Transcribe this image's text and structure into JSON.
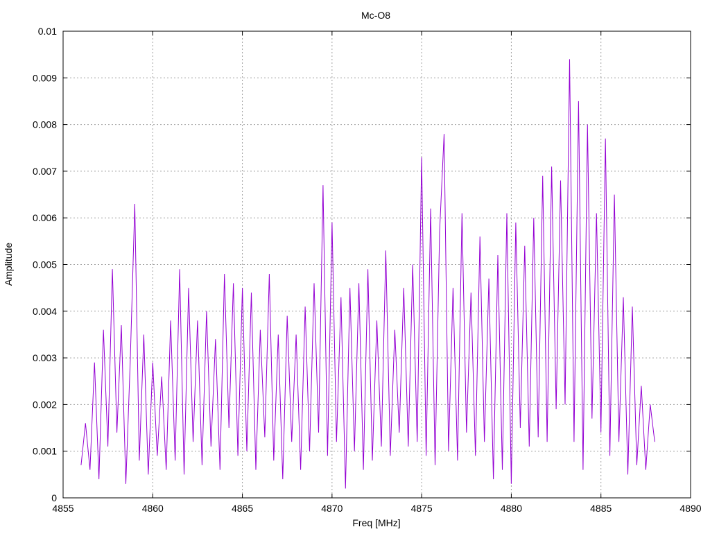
{
  "chart_data": {
    "type": "line",
    "title": "Mc-O8",
    "xlabel": "Freq [MHz]",
    "ylabel": "Amplitude",
    "xlim": [
      4855,
      4890
    ],
    "ylim": [
      0,
      0.01
    ],
    "xticks": [
      4855,
      4860,
      4865,
      4870,
      4875,
      4880,
      4885,
      4890
    ],
    "xtick_labels": [
      "4855",
      "4860",
      "4865",
      "4870",
      "4875",
      "4880",
      "4885",
      "4890"
    ],
    "yticks": [
      0,
      0.001,
      0.002,
      0.003,
      0.004,
      0.005,
      0.006,
      0.007,
      0.008,
      0.009,
      0.01
    ],
    "ytick_labels": [
      "0",
      "0.001",
      "0.002",
      "0.003",
      "0.004",
      "0.005",
      "0.006",
      "0.007",
      "0.008",
      "0.009",
      "0.01"
    ],
    "grid": true,
    "legend": "none",
    "series": [
      {
        "name": "Mc-O8",
        "color": "#9400d3",
        "x_start": 4856,
        "x_step": 0.25,
        "values": [
          0.0007,
          0.0016,
          0.0006,
          0.0029,
          0.0004,
          0.0036,
          0.0011,
          0.0049,
          0.0014,
          0.0037,
          0.0003,
          0.003,
          0.0063,
          0.0008,
          0.0035,
          0.0005,
          0.0029,
          0.0009,
          0.0026,
          0.0006,
          0.0038,
          0.0008,
          0.0049,
          0.0005,
          0.0045,
          0.0012,
          0.0038,
          0.0007,
          0.004,
          0.0011,
          0.0034,
          0.0006,
          0.0048,
          0.0015,
          0.0046,
          0.0009,
          0.0045,
          0.001,
          0.0044,
          0.0006,
          0.0036,
          0.0013,
          0.0048,
          0.0008,
          0.0035,
          0.0004,
          0.0039,
          0.0012,
          0.0035,
          0.0006,
          0.0041,
          0.001,
          0.0046,
          0.0014,
          0.0067,
          0.0009,
          0.0059,
          0.0012,
          0.0043,
          0.0002,
          0.0045,
          0.001,
          0.0046,
          0.0006,
          0.0049,
          0.0008,
          0.0038,
          0.0011,
          0.0053,
          0.0009,
          0.0036,
          0.0014,
          0.0045,
          0.0011,
          0.005,
          0.0012,
          0.0073,
          0.0009,
          0.0062,
          0.0007,
          0.0057,
          0.0078,
          0.001,
          0.0045,
          0.0008,
          0.0061,
          0.0014,
          0.0044,
          0.0009,
          0.0056,
          0.0012,
          0.0047,
          0.0004,
          0.0052,
          0.0006,
          0.0061,
          0.0003,
          0.0059,
          0.0015,
          0.0054,
          0.0011,
          0.006,
          0.0013,
          0.0069,
          0.0012,
          0.0071,
          0.0019,
          0.0068,
          0.002,
          0.0094,
          0.0012,
          0.0085,
          0.0006,
          0.008,
          0.0017,
          0.0061,
          0.0014,
          0.0077,
          0.0009,
          0.0065,
          0.0012,
          0.0043,
          0.0005,
          0.0041,
          0.0007,
          0.0024,
          0.0006,
          0.002,
          0.0012
        ]
      }
    ]
  }
}
